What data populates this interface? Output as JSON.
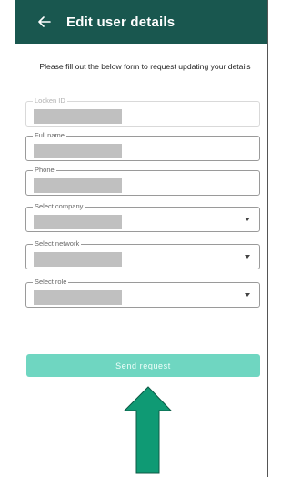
{
  "header": {
    "title": "Edit user details",
    "back_icon": "arrow-left-icon"
  },
  "form": {
    "intro": "Please fill out the below form to request updating your details",
    "fields": [
      {
        "label": "Locken ID",
        "value": "",
        "disabled": true
      },
      {
        "label": "Full name",
        "value": ""
      },
      {
        "label": "Phone",
        "value": ""
      },
      {
        "label": "Select company",
        "value": "",
        "dropdown": true
      },
      {
        "label": "Select network",
        "value": "",
        "dropdown": true
      },
      {
        "label": "Select role",
        "value": "",
        "dropdown": true
      }
    ],
    "submit_label": "Send request"
  },
  "colors": {
    "appbar": "#19574f",
    "button": "#6fd6c1",
    "annotation_arrow": "#0f9a74"
  }
}
